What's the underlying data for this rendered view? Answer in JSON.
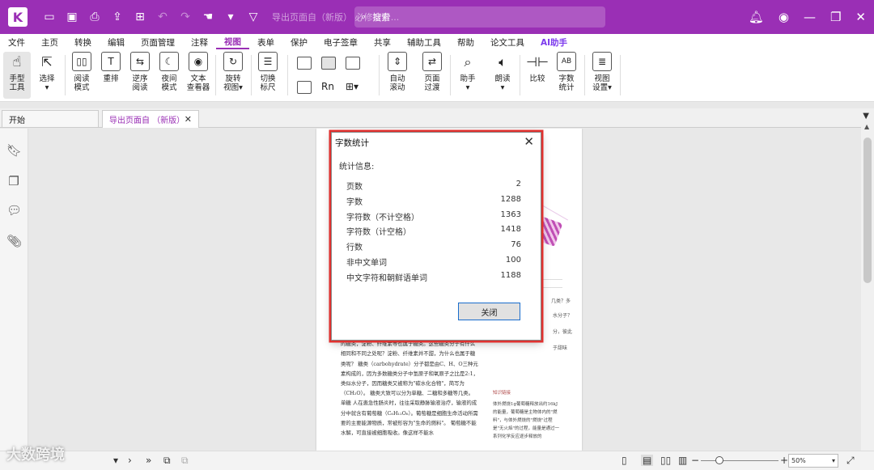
{
  "titlebar": {
    "doc_title": "导出页面自（新版）  必修1(分...",
    "search_placeholder": "搜索",
    "logo": "K",
    "icons": [
      "open-folder-icon",
      "save-icon",
      "print-icon",
      "export-icon",
      "new-icon",
      "undo-icon",
      "redo-icon",
      "hand-icon",
      "dropdown-icon"
    ],
    "window_buttons": [
      "minimize-icon",
      "restore-icon",
      "close-icon"
    ],
    "accent_color": "#9a2fb5"
  },
  "menu": {
    "items": [
      "文件",
      "主页",
      "转换",
      "编辑",
      "页面管理",
      "注释",
      "视图",
      "表单",
      "保护",
      "电子签章",
      "共享",
      "辅助工具",
      "帮助",
      "论文工具",
      "AI助手"
    ],
    "active": "视图"
  },
  "ribbon": {
    "hand_tool": [
      "手型",
      "工具"
    ],
    "select": "选择",
    "read_mode": [
      "阅读",
      "模式"
    ],
    "reflow": "重排",
    "reverse_read": [
      "逆序",
      "阅读"
    ],
    "night_mode": [
      "夜间",
      "模式"
    ],
    "text_viewer": [
      "文本",
      "查看器"
    ],
    "rotate_view": [
      "旋转",
      "视图"
    ],
    "toggle_ruler": [
      "切换",
      "标尺"
    ],
    "auto_scroll": [
      "自动",
      "滚动"
    ],
    "page_transition": [
      "页面",
      "过渡"
    ],
    "assistant": "助手",
    "read_aloud": "朗读",
    "compare": "比较",
    "word_count": [
      "字数",
      "统计"
    ],
    "view_settings": [
      "视图",
      "设置"
    ]
  },
  "tabs": {
    "start": "开始",
    "document": "导出页面自  （新版）  ..."
  },
  "dialog": {
    "title": "字数统计",
    "section": "统计信息:",
    "rows": [
      {
        "label": "页数",
        "value": "2"
      },
      {
        "label": "字数",
        "value": "1288"
      },
      {
        "label": "字符数（不计空格）",
        "value": "1363"
      },
      {
        "label": "字符数（计空格）",
        "value": "1418"
      },
      {
        "label": "行数",
        "value": "76"
      },
      {
        "label": "非中文单词",
        "value": "100"
      },
      {
        "label": "中文字符和朝鲜语单词",
        "value": "1188"
      }
    ],
    "close_label": "关闭",
    "highlight_color": "#e0312f"
  },
  "page": {
    "body": "糖白糖、砂糖、冰糖、葡萄糖等。其实，除了这些我们熟知的糖类，淀粉、纤维素等也属于糖类。这些糖类分子有什么相同和不同之处呢？淀粉、纤维素并不甜，为什么也属于糖类呢？  糖类（carbohydrate）分子都是由C、H、O三种元素构成的，因为多数糖类分子中氢原子和氧原子之比是2:1，类似水分子，因而糖类又被称为\"碳水化合物\"，简写为（CH₂O）。  糖类大致可以分为单糖、二糖和多糖等几类。  单糖  人在患急性肠炎时，往往采取静脉输液治疗，输液的成分中就含有葡萄糖（C₆H₁₂O₆）。葡萄糖是细胞生命活动所需要的主要能源物质，常被形容为\"生命的燃料\"。  葡萄糖不能水解，可直接被细胞吸收。像这样不能水",
    "side_title": "知识链接",
    "side_text": "体外燃烧1g葡萄糖释放出约16kJ的能量，葡萄糖是主物体内的\"燃料\"，与体外燃烧的\"燃烧\"过程是\"无火焰\"的过程，能量是通过一系列化学反应逐步释放的",
    "frag1": "几类？多",
    "frag2": "水分子？",
    "frag3": "分，彼此",
    "frag4": "于甜味"
  },
  "statusbar": {
    "zoom": "50%",
    "watermark": "大数跨境"
  }
}
